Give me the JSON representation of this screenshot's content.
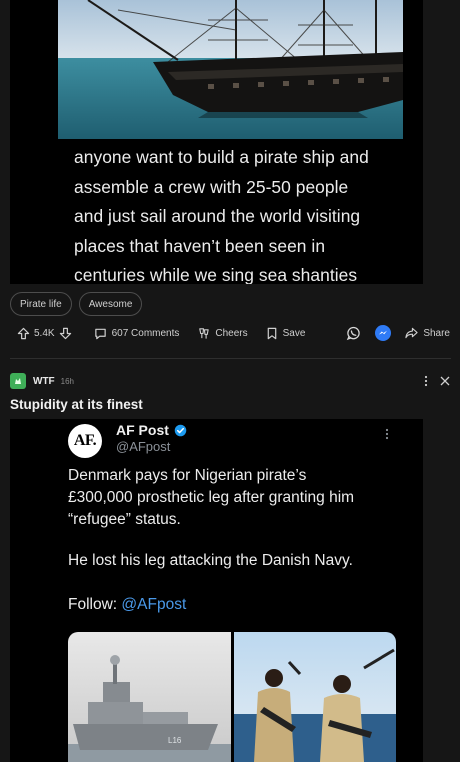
{
  "post1": {
    "meme_lines": [
      "anyone want to build a pirate ship and",
      "assemble a crew with 25-50 people",
      "and just sail around the world visiting",
      "places that haven’t been seen in",
      "centuries while we sing sea shanties"
    ],
    "tags": [
      "Pirate life",
      "Awesome"
    ],
    "vote_count": "5.4K",
    "comments_label": "607 Comments",
    "cheers_label": "Cheers",
    "save_label": "Save",
    "share_label": "Share"
  },
  "post2": {
    "subreddit": "WTF",
    "age": "16h",
    "title": "Stupidity at its finest",
    "tweet": {
      "logo_text": "AF.",
      "account_name": "AF Post",
      "handle": "@AFpost",
      "body_lines": [
        "Denmark pays for Nigerian pirate’s",
        "£300,000 prosthetic leg after granting him",
        "“refugee” status.",
        "He lost his leg attacking the Danish Navy."
      ],
      "follow_prefix": "Follow: ",
      "follow_link": "@AFpost",
      "ship_hull_number": "L16"
    }
  },
  "colors": {
    "background": "#161616",
    "card": "#000000",
    "link_blue": "#4a99e9",
    "verified_blue": "#1d9bf0",
    "subreddit_green": "#3fae58",
    "messenger_blue": "#2f7bf6"
  },
  "icons": {
    "upvote": "arrow-up-icon",
    "downvote": "arrow-down-icon",
    "comments": "comment-bubble-icon",
    "cheers": "cheers-icon",
    "save": "bookmark-icon",
    "whatsapp": "whatsapp-icon",
    "messenger": "messenger-icon",
    "share": "share-arrow-icon",
    "more": "more-dots-icon",
    "close": "close-icon",
    "verified": "verified-badge-icon"
  }
}
